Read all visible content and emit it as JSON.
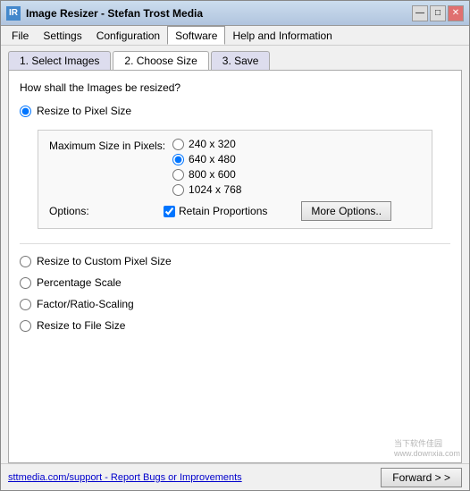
{
  "window": {
    "title": "Image Resizer - Stefan Trost Media",
    "icon": "IR"
  },
  "titleControls": {
    "minimize": "—",
    "maximize": "□",
    "close": "✕"
  },
  "menuBar": {
    "items": [
      {
        "label": "File",
        "id": "file"
      },
      {
        "label": "Settings",
        "id": "settings"
      },
      {
        "label": "Configuration",
        "id": "configuration"
      },
      {
        "label": "Software",
        "id": "software",
        "active": true
      },
      {
        "label": "Help and Information",
        "id": "help"
      }
    ]
  },
  "tabs": [
    {
      "label": "1. Select Images",
      "id": "select-images"
    },
    {
      "label": "2. Choose Size",
      "id": "choose-size",
      "active": true
    },
    {
      "label": "3. Save",
      "id": "save"
    }
  ],
  "content": {
    "question": "How shall the Images be resized?",
    "resizeOptions": [
      {
        "label": "Resize to Pixel Size",
        "id": "pixel-size",
        "selected": true
      },
      {
        "label": "Resize to Custom Pixel Size",
        "id": "custom-pixel"
      },
      {
        "label": "Percentage Scale",
        "id": "percentage"
      },
      {
        "label": "Factor/Ratio-Scaling",
        "id": "factor"
      },
      {
        "label": "Resize to File Size",
        "id": "file-size"
      }
    ],
    "pixelGroup": {
      "maxSizeLabel": "Maximum Size in Pixels:",
      "sizes": [
        {
          "label": "240 x 320",
          "value": "240x320"
        },
        {
          "label": "640 x 480",
          "value": "640x480",
          "selected": true
        },
        {
          "label": "800 x 600",
          "value": "800x600"
        },
        {
          "label": "1024 x 768",
          "value": "1024x768"
        }
      ],
      "optionsLabel": "Options:",
      "retainProportions": "Retain Proportions",
      "retainChecked": true,
      "moreOptionsBtn": "More Options.."
    }
  },
  "statusBar": {
    "linkText": "sttmedia.com/support - Report Bugs or Improvements",
    "forwardBtn": "Forward > >"
  },
  "watermark": "当下软件佳园\nwww.downxia.com"
}
